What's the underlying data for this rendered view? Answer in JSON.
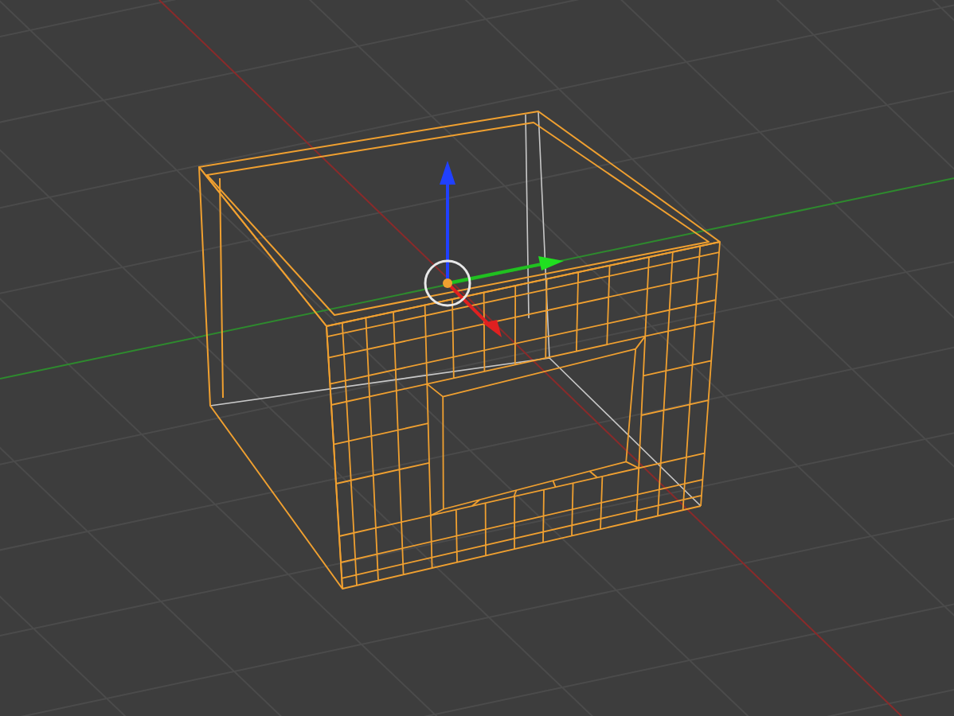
{
  "viewport": {
    "show_grid": true
  },
  "mesh": {
    "kind": "wireframe"
  }
}
